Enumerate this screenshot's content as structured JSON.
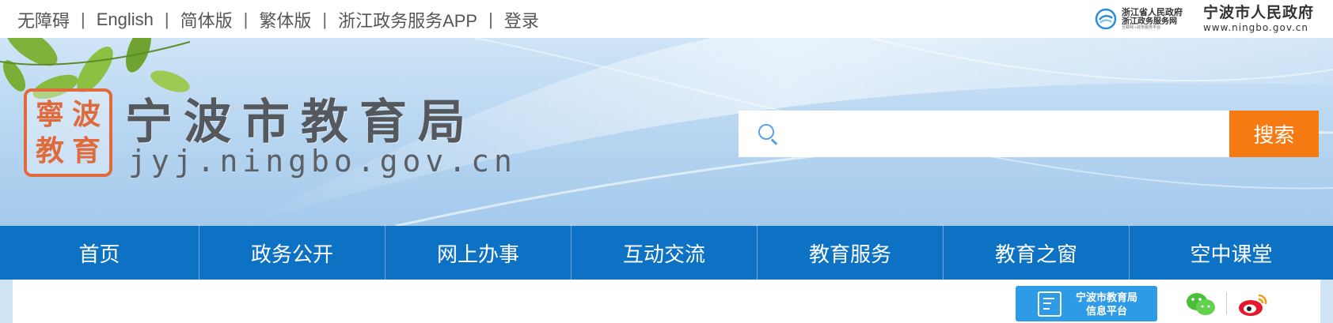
{
  "topbar": {
    "links": [
      "无障碍",
      "English",
      "简体版",
      "繁体版",
      "浙江政务服务APP",
      "登录"
    ],
    "separator": "|",
    "zj_logo": {
      "line1": "浙江省人民政府",
      "line2": "浙江政务服务网",
      "line3": "互联网+政务服务平台"
    },
    "nb_logo": {
      "name": "宁波市人民政府",
      "url": "www.ningbo.gov.cn"
    }
  },
  "banner": {
    "seal_chars": [
      "寧",
      "波",
      "教",
      "育"
    ],
    "title": "宁波市教育局",
    "domain": "jyj.ningbo.gov.cn"
  },
  "search": {
    "placeholder": "",
    "button_label": "搜索",
    "icon": "search-icon"
  },
  "nav": {
    "items": [
      "首页",
      "政务公开",
      "网上办事",
      "互动交流",
      "教育服务",
      "教育之窗",
      "空中课堂"
    ]
  },
  "lower": {
    "info_platform": {
      "line1": "宁波市教育局",
      "line2": "信息平台"
    },
    "social_icons": [
      "wechat-icon",
      "weibo-icon"
    ]
  },
  "colors": {
    "nav_bg": "#0d72c4",
    "search_button": "#f57a12",
    "seal": "#e06a3b",
    "info_platform": "#2d9be5"
  }
}
